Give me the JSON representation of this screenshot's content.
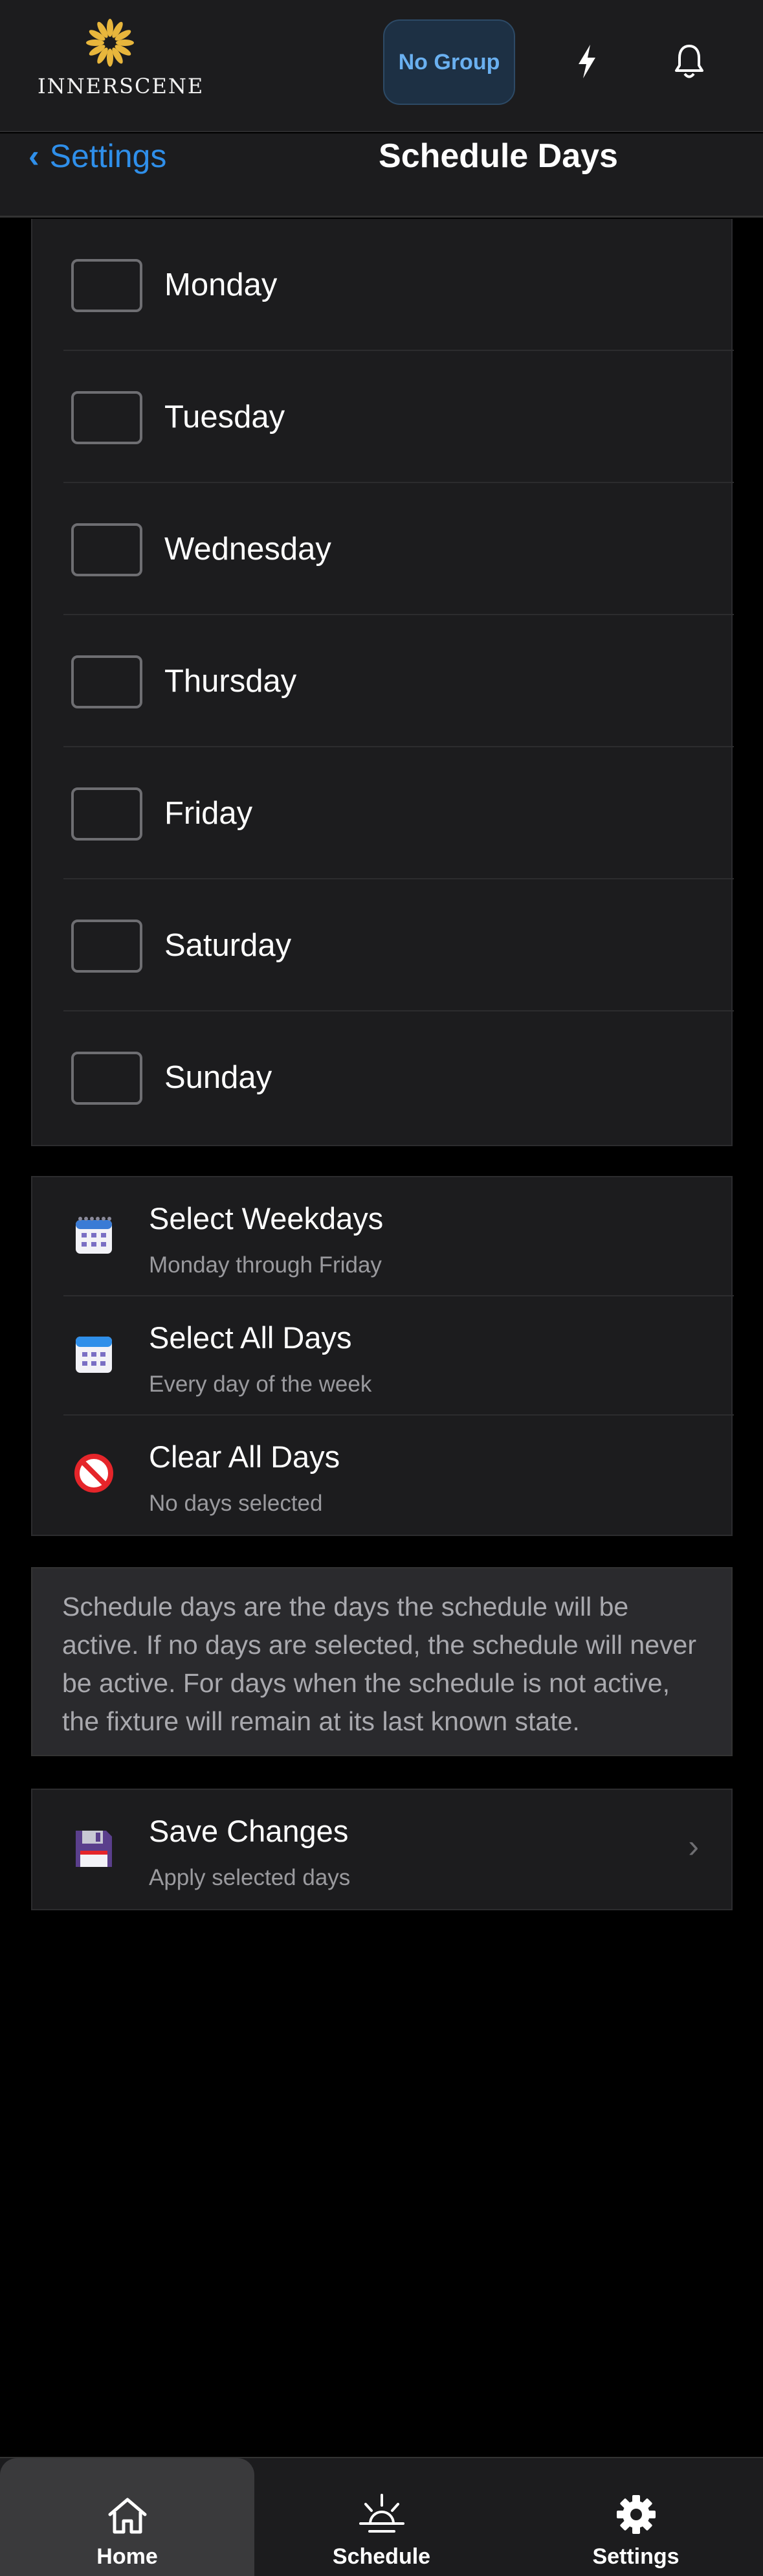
{
  "header": {
    "logo_text": "INNERSCENE",
    "group_button": "No Group",
    "colors": {
      "accent": "#2f8fea",
      "logo": "#e8b63c"
    }
  },
  "nav": {
    "back_label": "Settings",
    "title": "Schedule Days"
  },
  "days": [
    {
      "label": "Monday",
      "checked": false
    },
    {
      "label": "Tuesday",
      "checked": false
    },
    {
      "label": "Wednesday",
      "checked": false
    },
    {
      "label": "Thursday",
      "checked": false
    },
    {
      "label": "Friday",
      "checked": false
    },
    {
      "label": "Saturday",
      "checked": false
    },
    {
      "label": "Sunday",
      "checked": false
    }
  ],
  "actions": [
    {
      "title": "Select Weekdays",
      "subtitle": "Monday through Friday",
      "icon": "calendar-spiral-icon"
    },
    {
      "title": "Select All Days",
      "subtitle": "Every day of the week",
      "icon": "calendar-icon"
    },
    {
      "title": "Clear All Days",
      "subtitle": "No days selected",
      "icon": "prohibited-icon"
    }
  ],
  "info": {
    "text": "Schedule days are the days the schedule will be active. If no days are selected, the schedule will never be active. For days when the schedule is not active, the fixture will remain at its last known state."
  },
  "save": {
    "title": "Save Changes",
    "subtitle": "Apply selected days",
    "icon": "floppy-disk-icon"
  },
  "tabs": [
    {
      "label": "Home",
      "icon": "home-icon",
      "active": true
    },
    {
      "label": "Schedule",
      "icon": "sunrise-icon",
      "active": false
    },
    {
      "label": "Settings",
      "icon": "gear-icon",
      "active": false
    }
  ]
}
